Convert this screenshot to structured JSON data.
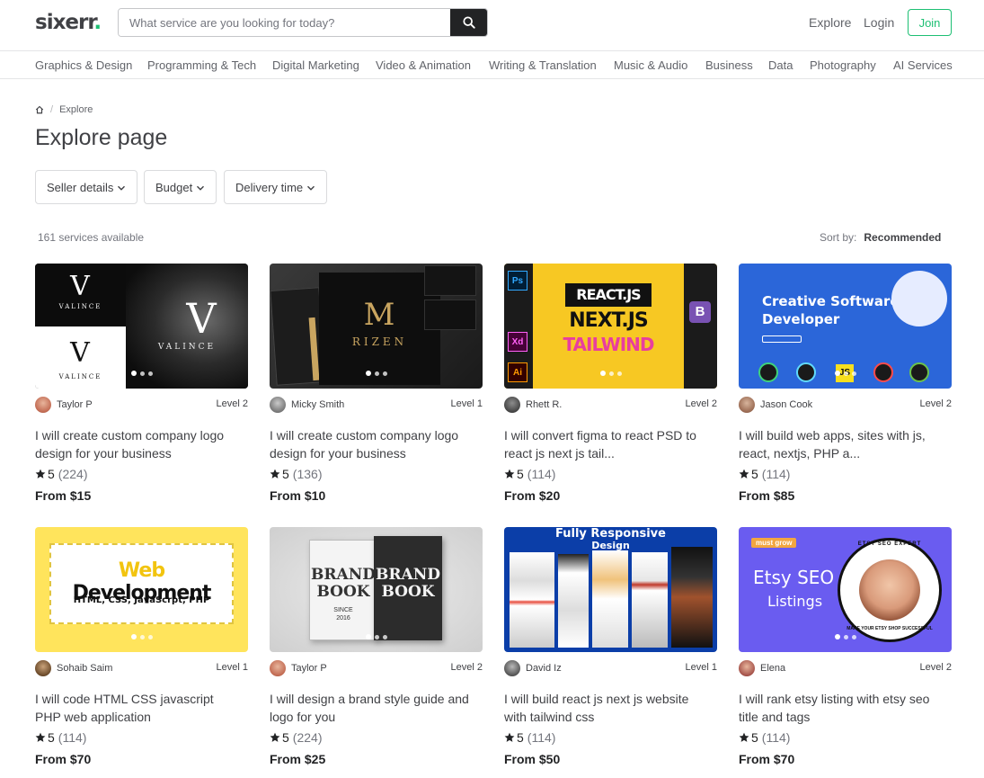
{
  "header": {
    "logo_text": "sixerr",
    "logo_dot": ".",
    "search_placeholder": "What service are you looking for today?",
    "nav": {
      "explore": "Explore",
      "login": "Login",
      "join": "Join"
    }
  },
  "categories": [
    "Graphics & Design",
    "Programming & Tech",
    "Digital Marketing",
    "Video & Animation",
    "Writing & Translation",
    "Music & Audio",
    "Business",
    "Data",
    "Photography",
    "AI Services"
  ],
  "breadcrumb": {
    "separator": "/",
    "current": "Explore"
  },
  "page_title": "Explore page",
  "filters": [
    "Seller details",
    "Budget",
    "Delivery time"
  ],
  "results": {
    "count_text": "161 services available",
    "sort_label": "Sort by:",
    "sort_value": "Recommended"
  },
  "gigs": [
    {
      "seller": "Taylor P",
      "level": "Level 2",
      "title": "I will create custom company logo design for your business",
      "rating": "5",
      "reviews": "(224)",
      "price": "From $15",
      "thumb_text": [
        "VALINCE",
        "VALINCE",
        "VALINCE"
      ]
    },
    {
      "seller": "Micky Smith",
      "level": "Level 1",
      "title": "I will create custom company logo design for your business",
      "rating": "5",
      "reviews": "(136)",
      "price": "From $10",
      "thumb_text": [
        "RIZEN"
      ]
    },
    {
      "seller": "Rhett R.",
      "level": "Level 2",
      "title": "I will convert figma to react PSD to react js next js tail...",
      "rating": "5",
      "reviews": "(114)",
      "price": "From $20",
      "thumb_text": [
        "REACT.JS",
        "NEXT.JS",
        "TAILWIND"
      ]
    },
    {
      "seller": "Jason Cook",
      "level": "Level 2",
      "title": "I will build web apps, sites with js, react, nextjs, PHP a...",
      "rating": "5",
      "reviews": "(114)",
      "price": "From $85",
      "thumb_text": [
        "Creative Software",
        "Developer"
      ]
    },
    {
      "seller": "Sohaib Saim",
      "level": "Level 1",
      "title": "I will code HTML CSS javascript PHP web application",
      "rating": "5",
      "reviews": "(114)",
      "price": "From $70",
      "thumb_text": [
        "Web",
        "Development",
        "HTML, CSS, JavaScrpt, PHP"
      ]
    },
    {
      "seller": "Taylor P",
      "level": "Level 2",
      "title": "I will design a brand style guide and logo for you",
      "rating": "5",
      "reviews": "(224)",
      "price": "From $25",
      "thumb_text": [
        "BRAND",
        "BOOK",
        "SINCE",
        "2016"
      ]
    },
    {
      "seller": "David Iz",
      "level": "Level 1",
      "title": "I will build react js next js website with tailwind css",
      "rating": "5",
      "reviews": "(114)",
      "price": "From $50",
      "thumb_text": [
        "Fully Responsive",
        "Design"
      ]
    },
    {
      "seller": "Elena",
      "level": "Level 2",
      "title": "I will rank etsy listing with etsy seo title and tags",
      "rating": "5",
      "reviews": "(114)",
      "price": "From $70",
      "thumb_text": [
        "must grow",
        "Etsy SEO",
        "Listings",
        "ETSY SEO EXPERT",
        "MAKE YOUR ETSY SHOP SUCCESSFUL"
      ]
    }
  ],
  "colors": {
    "brand_green": "#1dbf73",
    "text": "#404145",
    "muted": "#74767e"
  }
}
